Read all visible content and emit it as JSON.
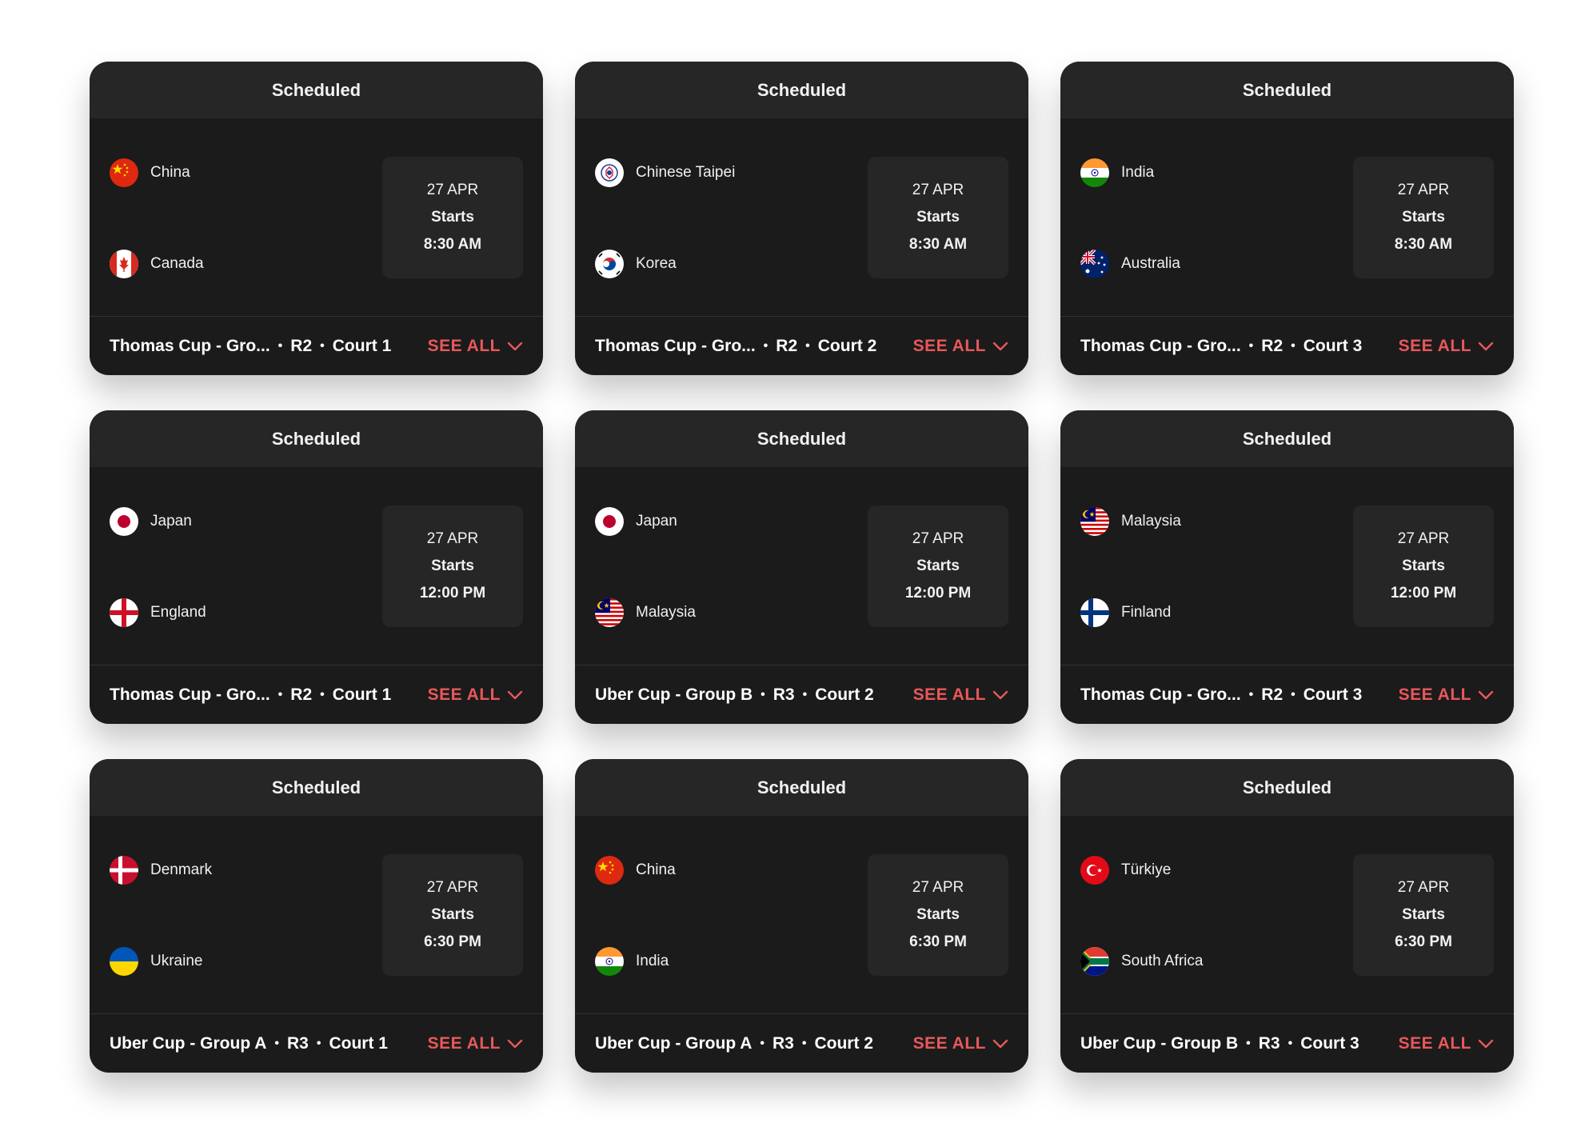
{
  "colors": {
    "card_bg": "#1b1b1b",
    "header_bg": "#262626",
    "accent": "#e8585a",
    "text": "#ffffff"
  },
  "see_all_label": "SEE ALL",
  "matches": [
    {
      "status": "Scheduled",
      "team1": {
        "name": "China",
        "flag": "china-flag-icon"
      },
      "team2": {
        "name": "Canada",
        "flag": "canada-flag-icon"
      },
      "date": "27 APR",
      "starts": "Starts",
      "time": "8:30 AM",
      "event": "Thomas Cup - Gro...",
      "round": "R2",
      "court": "Court 1"
    },
    {
      "status": "Scheduled",
      "team1": {
        "name": "Chinese Taipei",
        "flag": "chinese-taipei-flag-icon"
      },
      "team2": {
        "name": "Korea",
        "flag": "korea-flag-icon"
      },
      "date": "27 APR",
      "starts": "Starts",
      "time": "8:30 AM",
      "event": "Thomas Cup - Gro...",
      "round": "R2",
      "court": "Court 2"
    },
    {
      "status": "Scheduled",
      "team1": {
        "name": "India",
        "flag": "india-flag-icon"
      },
      "team2": {
        "name": "Australia",
        "flag": "australia-flag-icon"
      },
      "date": "27 APR",
      "starts": "Starts",
      "time": "8:30 AM",
      "event": "Thomas Cup - Gro...",
      "round": "R2",
      "court": "Court 3"
    },
    {
      "status": "Scheduled",
      "team1": {
        "name": "Japan",
        "flag": "japan-flag-icon"
      },
      "team2": {
        "name": "England",
        "flag": "england-flag-icon"
      },
      "date": "27 APR",
      "starts": "Starts",
      "time": "12:00 PM",
      "event": "Thomas Cup - Gro...",
      "round": "R2",
      "court": "Court 1"
    },
    {
      "status": "Scheduled",
      "team1": {
        "name": "Japan",
        "flag": "japan-flag-icon"
      },
      "team2": {
        "name": "Malaysia",
        "flag": "malaysia-flag-icon"
      },
      "date": "27 APR",
      "starts": "Starts",
      "time": "12:00 PM",
      "event": "Uber Cup - Group B",
      "round": "R3",
      "court": "Court 2"
    },
    {
      "status": "Scheduled",
      "team1": {
        "name": "Malaysia",
        "flag": "malaysia-flag-icon"
      },
      "team2": {
        "name": "Finland",
        "flag": "finland-flag-icon"
      },
      "date": "27 APR",
      "starts": "Starts",
      "time": "12:00 PM",
      "event": "Thomas Cup - Gro...",
      "round": "R2",
      "court": "Court 3"
    },
    {
      "status": "Scheduled",
      "team1": {
        "name": "Denmark",
        "flag": "denmark-flag-icon"
      },
      "team2": {
        "name": "Ukraine",
        "flag": "ukraine-flag-icon"
      },
      "date": "27 APR",
      "starts": "Starts",
      "time": "6:30 PM",
      "event": "Uber Cup - Group A",
      "round": "R3",
      "court": "Court 1"
    },
    {
      "status": "Scheduled",
      "team1": {
        "name": "China",
        "flag": "china-flag-icon"
      },
      "team2": {
        "name": "India",
        "flag": "india-flag-icon"
      },
      "date": "27 APR",
      "starts": "Starts",
      "time": "6:30 PM",
      "event": "Uber Cup - Group A",
      "round": "R3",
      "court": "Court 2"
    },
    {
      "status": "Scheduled",
      "team1": {
        "name": "Türkiye",
        "flag": "turkiye-flag-icon"
      },
      "team2": {
        "name": "South Africa",
        "flag": "south-africa-flag-icon"
      },
      "date": "27 APR",
      "starts": "Starts",
      "time": "6:30 PM",
      "event": "Uber Cup - Group B",
      "round": "R3",
      "court": "Court 3"
    }
  ]
}
